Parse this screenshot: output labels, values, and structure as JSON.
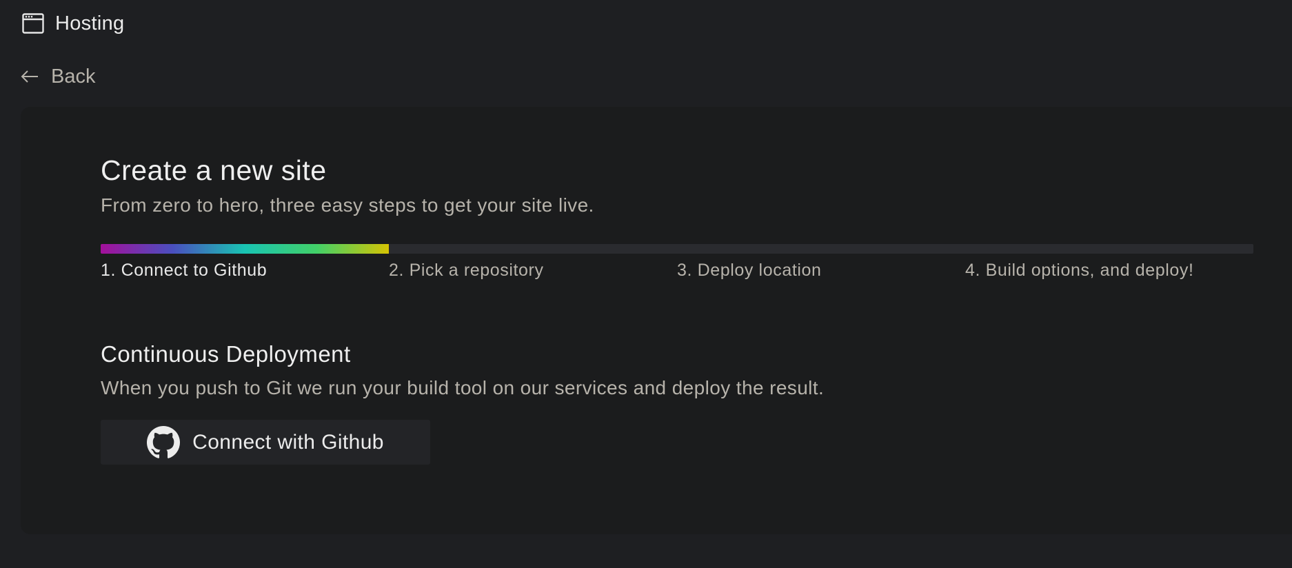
{
  "header": {
    "app_icon": "browser-window-icon",
    "title": "Hosting"
  },
  "nav": {
    "back_icon": "arrow-left-icon",
    "back_label": "Back"
  },
  "main": {
    "title": "Create a new site",
    "subtitle": "From zero to hero, three easy steps to get your site live.",
    "progress": {
      "fraction": 0.25,
      "gradient_colors": [
        "#a4109a",
        "#4a4fbf",
        "#19c4b3",
        "#42d068",
        "#d5c304"
      ],
      "track_color": "#2a2b2f"
    },
    "steps": [
      {
        "label": "1. Connect to Github",
        "active": true
      },
      {
        "label": "2. Pick a repository",
        "active": false
      },
      {
        "label": "3. Deploy location",
        "active": false
      },
      {
        "label": "4. Build options, and deploy!",
        "active": false
      }
    ],
    "section": {
      "title": "Continuous Deployment",
      "description": "When you push to Git we run your build tool on our services and deploy the result.",
      "button_icon": "github-icon",
      "button_label": "Connect with Github"
    }
  },
  "colors": {
    "background": "#1e1f22",
    "card": "#1b1c1d",
    "text_primary": "#efefef",
    "text_secondary": "#b7b3ab",
    "button_bg": "#232427"
  }
}
